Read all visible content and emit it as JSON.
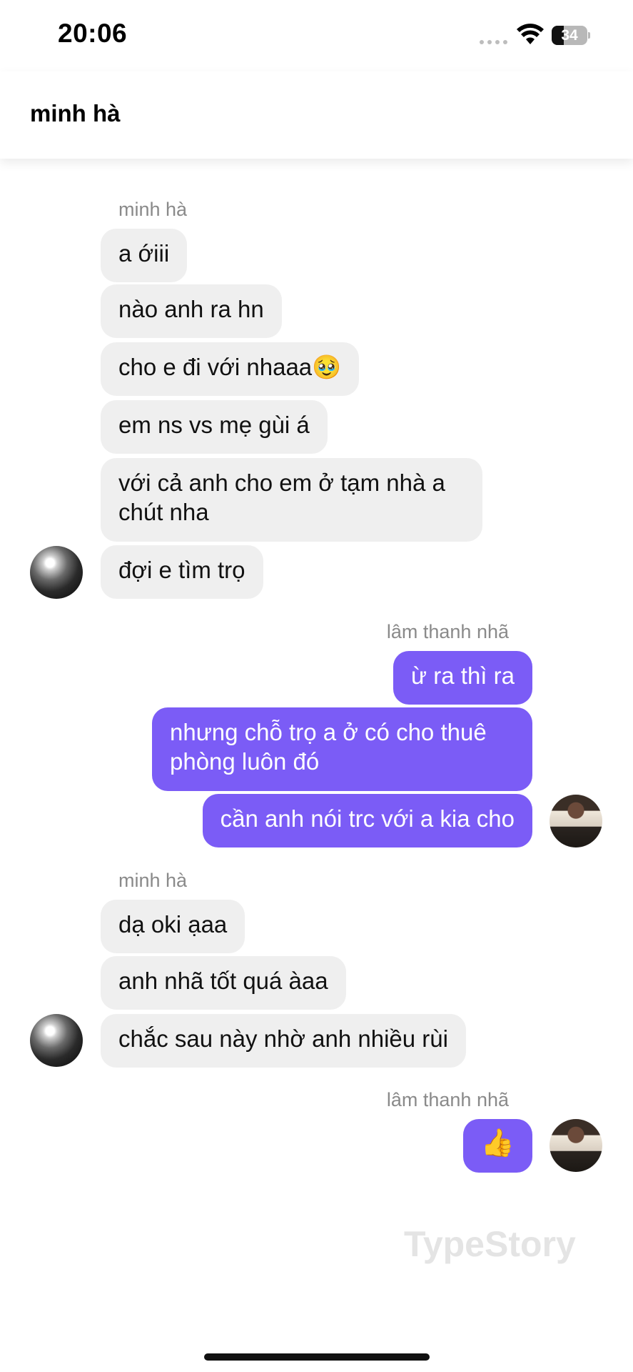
{
  "status_bar": {
    "time": "20:06",
    "battery": "34",
    "battery_level": 0.34
  },
  "header": {
    "title": "minh hà"
  },
  "messages": [
    {
      "sender": "minh hà",
      "bubbles": [
        "a ớiii",
        "nào anh ra hn",
        "cho e đi với nhaaa🥹",
        "em ns vs mẹ gùi á",
        "với cả anh cho em ở tạm nhà a chút nha",
        "đợi e tìm trọ"
      ]
    },
    {
      "sender": "lâm thanh nhã",
      "bubbles": [
        "ừ ra thì ra",
        "nhưng chỗ trọ a ở có cho thuê phòng luôn đó",
        "cần anh nói trc với a kia cho"
      ]
    },
    {
      "sender": "minh hà",
      "bubbles": [
        "dạ oki ạaa",
        "anh nhã tốt quá àaa",
        "chắc sau này nhờ anh nhiều rùi"
      ]
    },
    {
      "sender": "lâm thanh nhã",
      "bubbles": [
        "👍"
      ]
    }
  ],
  "watermark": "TypeStory",
  "colors": {
    "outgoing": "#7b5cf6",
    "incoming": "#efefef"
  },
  "icons": [
    "signal-icon",
    "wifi-icon",
    "battery-icon"
  ]
}
